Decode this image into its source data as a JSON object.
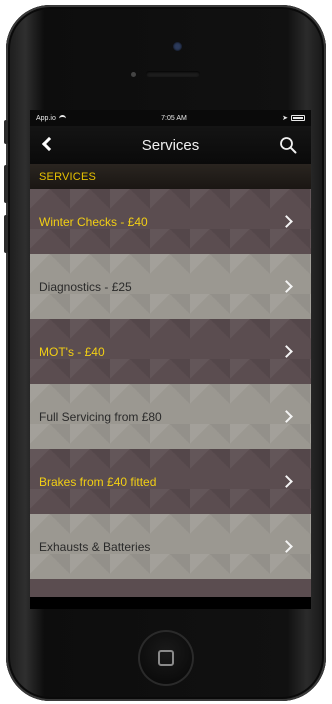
{
  "status_bar": {
    "carrier": "App.io",
    "time": "7:05 AM"
  },
  "nav": {
    "title": "Services"
  },
  "section": {
    "header": "SERVICES"
  },
  "services": [
    {
      "label": "Winter Checks - £40",
      "style": "dark"
    },
    {
      "label": "Diagnostics - £25",
      "style": "light"
    },
    {
      "label": "MOT's - £40",
      "style": "dark"
    },
    {
      "label": "Full Servicing from £80",
      "style": "light"
    },
    {
      "label": "Brakes from £40 fitted",
      "style": "dark"
    },
    {
      "label": "Exhausts & Batteries",
      "style": "light"
    }
  ],
  "colors": {
    "accent": "#f2cf14",
    "dark_row": "#5b4d50",
    "light_row": "#9b9891"
  }
}
